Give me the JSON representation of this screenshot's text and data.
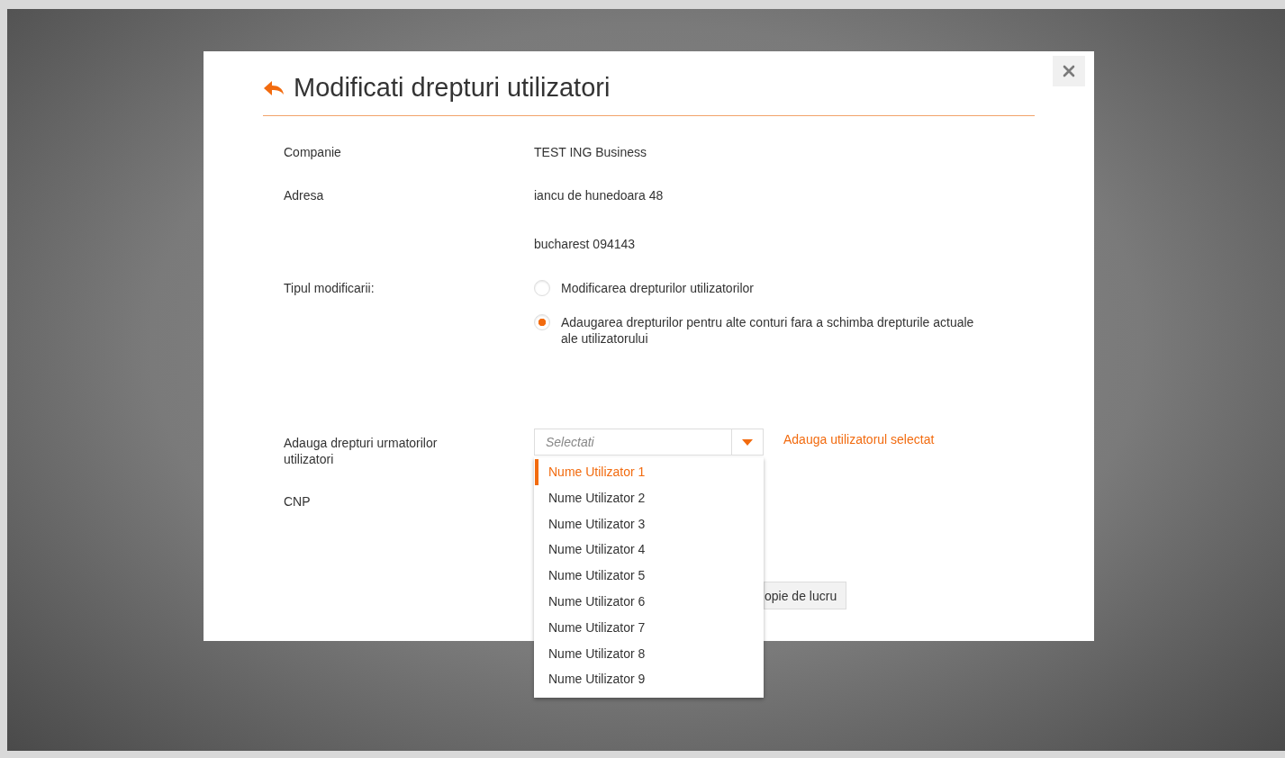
{
  "dialog": {
    "title": "Modificati drepturi utilizatori",
    "fields": [
      {
        "label": "Companie",
        "value": "TEST ING Business"
      },
      {
        "label": "Adresa",
        "value": "iancu de hunedoara 48"
      },
      {
        "value": "bucharest 094143"
      }
    ],
    "modification_type": {
      "label": "Tipul modificarii:",
      "options": [
        {
          "label": "Modificarea drepturilor utilizatorilor",
          "selected": false
        },
        {
          "label": "Adaugarea drepturilor pentru alte conturi fara a schimba drepturile actuale ale utilizatorului",
          "selected": true
        }
      ]
    },
    "add_users": {
      "label": "Adauga drepturi urmatorilor utilizatori",
      "select": {
        "placeholder": "Selectati",
        "expanded": true,
        "options": [
          {
            "label": "Nume Utilizator 1",
            "selected": true
          },
          {
            "label": "Nume Utilizator 2",
            "selected": false
          },
          {
            "label": "Nume Utilizator 3",
            "selected": false
          },
          {
            "label": "Nume Utilizator 4",
            "selected": false
          },
          {
            "label": "Nume Utilizator 5",
            "selected": false
          },
          {
            "label": "Nume Utilizator 6",
            "selected": false
          },
          {
            "label": "Nume Utilizator 7",
            "selected": false
          },
          {
            "label": "Nume Utilizator 8",
            "selected": false
          },
          {
            "label": "Nume Utilizator 9",
            "selected": false
          }
        ]
      },
      "add_link": "Adauga utilizatorul selectat"
    },
    "cnp": {
      "label": "CNP"
    },
    "partial_button": "opie de lucru"
  }
}
